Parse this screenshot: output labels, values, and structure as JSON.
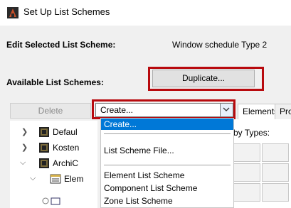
{
  "window": {
    "title": "Set Up List Schemes"
  },
  "edit": {
    "label": "Edit Selected List Scheme:",
    "value": "Window schedule Type 2"
  },
  "available": {
    "label": "Available List Schemes:",
    "duplicate_label": "Duplicate..."
  },
  "toolbar": {
    "delete_label": "Delete",
    "create_value": "Create..."
  },
  "tabs": [
    {
      "label": "Elements"
    },
    {
      "label": "Pro"
    }
  ],
  "by_types_label": "by Types:",
  "tree": [
    {
      "label": "Defaul"
    },
    {
      "label": "Kosten"
    },
    {
      "label": "ArchiC"
    },
    {
      "label": "Elem"
    }
  ],
  "dropdown": {
    "items": [
      {
        "label": "Create..."
      },
      {
        "label": "List Scheme File..."
      },
      {
        "label": "Element List Scheme"
      },
      {
        "label": "Component List Scheme"
      },
      {
        "label": "Zone List Scheme"
      }
    ]
  },
  "colors": {
    "highlight": "#b80a0e",
    "selection": "#0078d7"
  }
}
